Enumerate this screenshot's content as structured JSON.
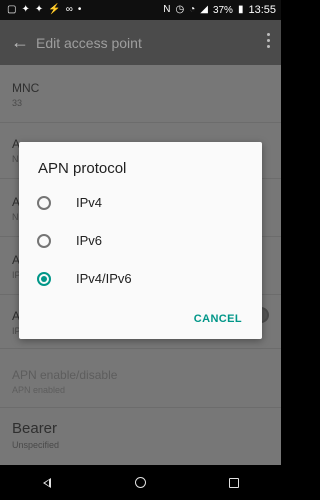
{
  "status": {
    "left_icons": [
      "notification-icon",
      "twitter-icon",
      "twitter-icon",
      "lightning-icon",
      "voicemail-icon",
      "more-icon"
    ],
    "right_icons": [
      "n-icon",
      "alarm-icon",
      "wifi-icon",
      "signal-icon"
    ],
    "battery": "37%",
    "time": "13:55"
  },
  "app_bar": {
    "title": "Edit access point"
  },
  "prefs": [
    {
      "title": "MNC",
      "summary": "33"
    },
    {
      "title": "A",
      "summary": "N"
    },
    {
      "title": "A",
      "summary": "N"
    },
    {
      "title": "A",
      "summary": "IP"
    },
    {
      "title": "A",
      "summary": "IP"
    },
    {
      "title": "APN enable/disable",
      "summary": "APN enabled"
    },
    {
      "title": "Bearer",
      "summary": "Unspecified"
    }
  ],
  "dialog": {
    "title": "APN protocol",
    "options": [
      {
        "label": "IPv4",
        "checked": false
      },
      {
        "label": "IPv6",
        "checked": false
      },
      {
        "label": "IPv4/IPv6",
        "checked": true
      }
    ],
    "cancel_label": "CANCEL"
  },
  "colors": {
    "accent": "#009688",
    "scrim": "#777777",
    "toolbar": "#4b4b4b"
  }
}
